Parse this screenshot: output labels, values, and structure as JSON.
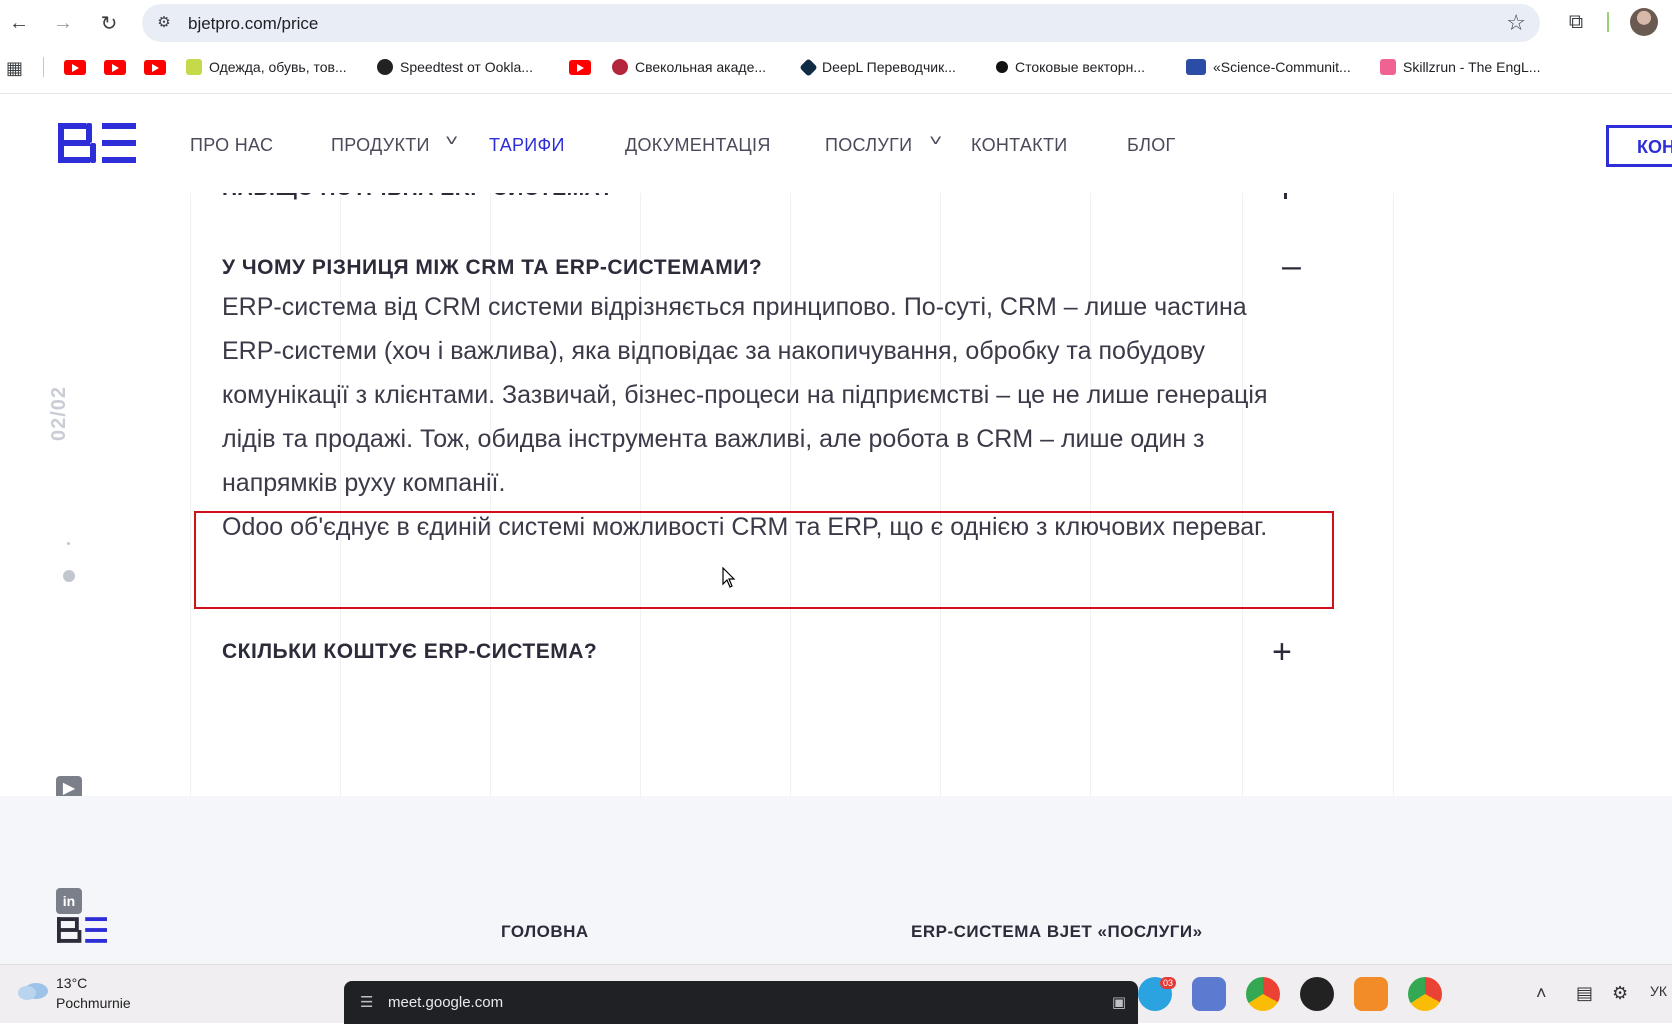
{
  "browser": {
    "url": "bjetpro.com/price",
    "bookmarks": [
      {
        "label": "",
        "kind": "youtube"
      },
      {
        "label": "",
        "kind": "youtube"
      },
      {
        "label": "",
        "kind": "youtube"
      },
      {
        "label": "Одежда, обувь, тов...",
        "kind": "shop"
      },
      {
        "label": "Speedtest от Ookla...",
        "kind": "speedtest"
      },
      {
        "label": "",
        "kind": "youtube"
      },
      {
        "label": "Свекольная акаде...",
        "kind": "beet"
      },
      {
        "label": "DeepL Переводчик...",
        "kind": "deepl"
      },
      {
        "label": "Стоковые векторн...",
        "kind": "stock"
      },
      {
        "label": "«Science-Communit...",
        "kind": "science"
      },
      {
        "label": "Skillzrun - The EngL...",
        "kind": "skillzrun"
      }
    ]
  },
  "site": {
    "menu": {
      "about": "ПРО НАС",
      "products": "ПРОДУКТИ",
      "pricing": "ТАРИФИ",
      "docs": "ДОКУМЕНТАЦІЯ",
      "services": "ПОСЛУГИ",
      "contacts": "КОНТАКТИ",
      "blog": "БЛОГ"
    },
    "contact_button": "КОН",
    "accent_color": "#2e2ed8"
  },
  "content": {
    "counter": "02/02",
    "faq_cut": "НАВІЩО ПОТРІБНА ERP-СИСТЕМА?",
    "faq_open_question": "У ЧОМУ РІЗНИЦЯ МІЖ CRM ТА ERP-СИСТЕМАМИ?",
    "faq_open_sign": "–",
    "answer_p1": "ERP-система від CRM системи відрізняється принципово. По-суті, CRM – лише частина ERP-системи (хоч і важлива), яка відповідає за накопичування, обробку та побудову комунікації з клієнтами. Зазвичай, бізнес-процеси на підприємстві – це не лише генерація лідів та продажі. Тож, обидва інструмента важливі, але робота в CRM – лише один з напрямків руху компанії.",
    "answer_p2": "Odoo об'єднує в єдиній системі можливості CRM та ERP, що є однією з ключових переваг.",
    "faq_closed_question": "СКІЛЬКИ КОШТУЄ ERP-СИСТЕМА?",
    "faq_closed_sign": "+"
  },
  "social": {
    "youtube": "youtube-icon",
    "facebook": "facebook-icon",
    "linkedin": "in"
  },
  "footer": {
    "col1": "ГОЛОВНА",
    "col2": "ERP-СИСТЕМА ВJET «ПОСЛУГИ»"
  },
  "taskbar": {
    "temp": "13°C",
    "weather": "Pochmurnie",
    "meet_url": "meet.google.com",
    "telegram_badge": "03",
    "lang": "УК"
  }
}
